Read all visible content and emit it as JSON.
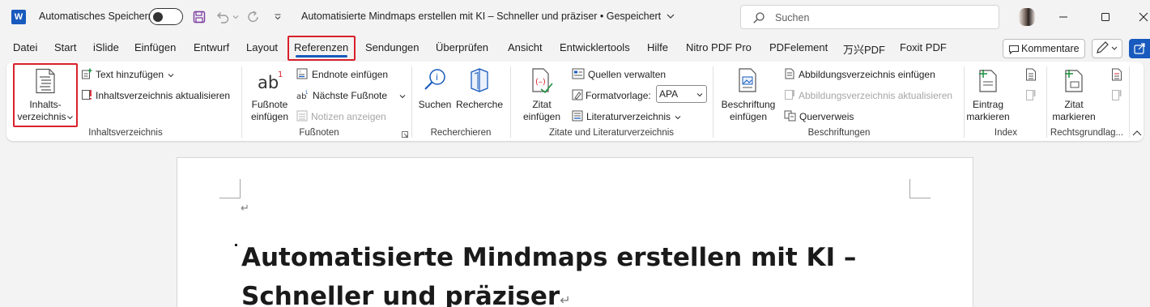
{
  "title_bar": {
    "app_icon": "word-icon",
    "autosave_label": "Automatisches Speichern",
    "autosave_on": false,
    "document_title": "Automatisierte Mindmaps erstellen mit KI – Schneller und präziser • Gespeichert",
    "search_placeholder": "Suchen"
  },
  "menu_tabs": [
    "Datei",
    "Start",
    "iSlide",
    "Einfügen",
    "Entwurf",
    "Layout",
    "Referenzen",
    "Sendungen",
    "Überprüfen",
    "Ansicht",
    "Entwicklertools",
    "Hilfe",
    "Nitro PDF Pro",
    "PDFelement",
    "万兴PDF",
    "Foxit PDF"
  ],
  "active_tab": "Referenzen",
  "header_buttons": {
    "comments": "Kommentare"
  },
  "ribbon": {
    "toc": {
      "big_button": "Inhalts-\nverzeichnis",
      "add_text": "Text hinzufügen",
      "update": "Inhaltsverzeichnis aktualisieren",
      "group": "Inhaltsverzeichnis"
    },
    "footnotes": {
      "insert": "Fußnote\neinfügen",
      "endnote": "Endnote einfügen",
      "next": "Nächste Fußnote",
      "show": "Notizen anzeigen",
      "group": "Fußnoten"
    },
    "research": {
      "search": "Suchen",
      "research": "Recherche",
      "group": "Recherchieren"
    },
    "citations": {
      "insert": "Zitat\neinfügen",
      "manage": "Quellen verwalten",
      "style_label": "Formatvorlage:",
      "style_value": "APA",
      "bibliography": "Literaturverzeichnis",
      "group": "Zitate und Literaturverzeichnis"
    },
    "captions": {
      "insert": "Beschriftung\neinfügen",
      "insert_table": "Abbildungsverzeichnis einfügen",
      "update_table": "Abbildungsverzeichnis aktualisieren",
      "cross_ref": "Querverweis",
      "group": "Beschriftungen"
    },
    "index": {
      "mark": "Eintrag\nmarkieren",
      "group": "Index"
    },
    "authorities": {
      "mark": "Zitat\nmarkieren",
      "group": "Rechtsgrundlag..."
    }
  },
  "document": {
    "heading_line1": "Automatisierte Mindmaps erstellen mit KI –",
    "heading_line2": "Schneller und präziser",
    "paragraph_mark": "↵"
  },
  "colors": {
    "accent": "#185abd",
    "highlight_frame": "#d9202b",
    "ribbon_bg": "#ffffff",
    "window_bg": "#f3f3f3"
  }
}
